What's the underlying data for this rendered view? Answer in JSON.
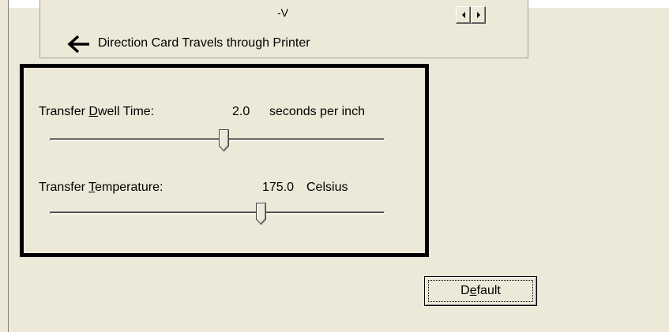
{
  "preview": {
    "flip_label": "-V",
    "direction_label": "Direction Card Travels through Printer",
    "arrow_icon": "left-arrow-icon",
    "scroll_left_icon": "scroll-left-arrow-icon",
    "scroll_right_icon": "scroll-right-arrow-icon"
  },
  "dwell": {
    "label_before": "Transfer ",
    "label_mnemonic": "D",
    "label_after": "well Time:",
    "value": "2.0",
    "unit": "seconds per inch",
    "slider_fraction": 0.52
  },
  "temperature": {
    "label_before": "Transfer ",
    "label_mnemonic": "T",
    "label_after": "emperature:",
    "value": "175.0",
    "unit": "Celsius",
    "slider_fraction": 0.63
  },
  "default_button": {
    "label_before": "D",
    "label_mnemonic": "e",
    "label_after": "fault"
  },
  "colors": {
    "background": "#ece9d8",
    "highlight_box": "#000000"
  }
}
